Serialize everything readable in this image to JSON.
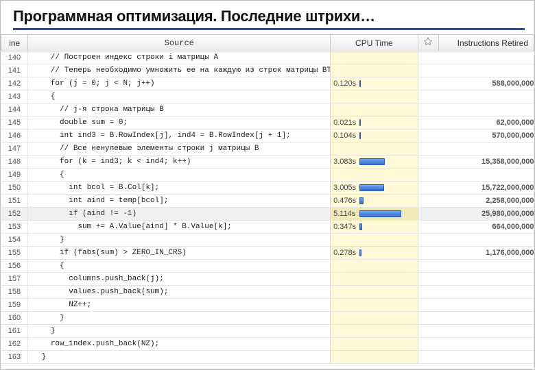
{
  "slide": {
    "title": "Программная оптимизация. Последние штрихи…"
  },
  "headers": {
    "line": "ine",
    "source": "Source",
    "cpu": "CPU Time",
    "star": "",
    "ir": "Instructions Retired"
  },
  "max_cpu": 5.2,
  "rows": [
    {
      "line": "140",
      "src": "    // Построен индекс строки i матрицы A",
      "comment": true
    },
    {
      "line": "141",
      "src": "    // Теперь необходимо умножить ее на каждую из строк матрицы BT",
      "comment": true
    },
    {
      "line": "142",
      "src": "    for (j = 0; j < N; j++)",
      "cpu": "0.120s",
      "cpu_v": 0.12,
      "ir": "588,000,000"
    },
    {
      "line": "143",
      "src": "    {"
    },
    {
      "line": "144",
      "src": "      // j-я строка матрицы B",
      "comment": true
    },
    {
      "line": "145",
      "src": "      double sum = 0;",
      "cpu": "0.021s",
      "cpu_v": 0.021,
      "ir": "62,000,000"
    },
    {
      "line": "146",
      "src": "      int ind3 = B.RowIndex[j], ind4 = B.RowIndex[j + 1];",
      "cpu": "0.104s",
      "cpu_v": 0.104,
      "ir": "570,000,000"
    },
    {
      "line": "147",
      "src": "      // Все ненулевые элементы строки j матрицы B",
      "comment": true
    },
    {
      "line": "148",
      "src": "      for (k = ind3; k < ind4; k++)",
      "cpu": "3.083s",
      "cpu_v": 3.083,
      "ir": "15,358,000,000"
    },
    {
      "line": "149",
      "src": "      {"
    },
    {
      "line": "150",
      "src": "        int bcol = B.Col[k];",
      "cpu": "3.005s",
      "cpu_v": 3.005,
      "ir": "15,722,000,000"
    },
    {
      "line": "151",
      "src": "        int aind = temp[bcol];",
      "cpu": "0.476s",
      "cpu_v": 0.476,
      "ir": "2,258,000,000"
    },
    {
      "line": "152",
      "src": "        if (aind != -1)",
      "cpu": "5.114s",
      "cpu_v": 5.114,
      "ir": "25,980,000,000",
      "hl": true
    },
    {
      "line": "153",
      "src": "          sum += A.Value[aind] * B.Value[k];",
      "cpu": "0.347s",
      "cpu_v": 0.347,
      "ir": "664,000,000"
    },
    {
      "line": "154",
      "src": "      }"
    },
    {
      "line": "155",
      "src": "      if (fabs(sum) > ZERO_IN_CRS)",
      "cpu": "0.278s",
      "cpu_v": 0.278,
      "ir": "1,176,000,000"
    },
    {
      "line": "156",
      "src": "      {"
    },
    {
      "line": "157",
      "src": "        columns.push_back(j);"
    },
    {
      "line": "158",
      "src": "        values.push_back(sum);"
    },
    {
      "line": "159",
      "src": "        NZ++;"
    },
    {
      "line": "160",
      "src": "      }"
    },
    {
      "line": "161",
      "src": "    }"
    },
    {
      "line": "162",
      "src": "    row_index.push_back(NZ);"
    },
    {
      "line": "163",
      "src": "  }"
    }
  ]
}
